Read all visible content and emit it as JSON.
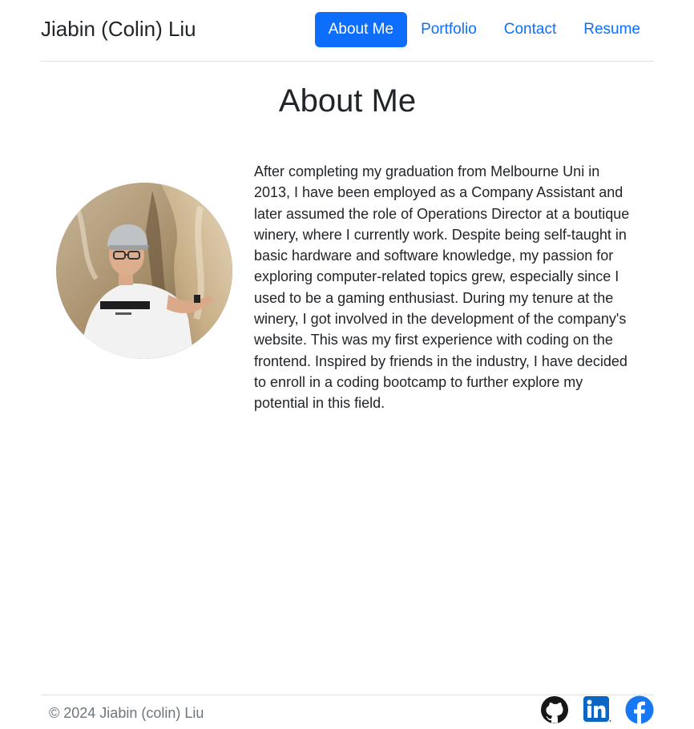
{
  "header": {
    "brand": "Jiabin (Colin) Liu",
    "nav": [
      {
        "label": "About Me",
        "active": true
      },
      {
        "label": "Portfolio",
        "active": false
      },
      {
        "label": "Contact",
        "active": false
      },
      {
        "label": "Resume",
        "active": false
      }
    ]
  },
  "main": {
    "title": "About Me",
    "avatar_icon": "profile-photo",
    "bio": "After completing my graduation from Melbourne Uni in 2013, I have been employed as a Company Assistant and later assumed the role of Operations Director at a boutique winery, where I currently work. Despite being self-taught in basic hardware and software knowledge, my passion for exploring computer-related topics grew, especially since I used to be a gaming enthusiast. During my tenure at the winery, I got involved in the development of the company's website. This was my first experience with coding on the frontend. Inspired by friends in the industry, I have decided to enroll in a coding bootcamp to further explore my potential in this field."
  },
  "footer": {
    "copyright": "© 2024 Jiabin (colin) Liu",
    "socials": [
      {
        "icon": "github-icon"
      },
      {
        "icon": "linkedin-icon"
      },
      {
        "icon": "facebook-icon"
      }
    ]
  },
  "colors": {
    "accent": "#0d6efd",
    "text": "#212529",
    "muted": "#6c757d",
    "border": "#dee2e6",
    "linkedin": "#0a66c2",
    "facebook": "#1877f2"
  }
}
